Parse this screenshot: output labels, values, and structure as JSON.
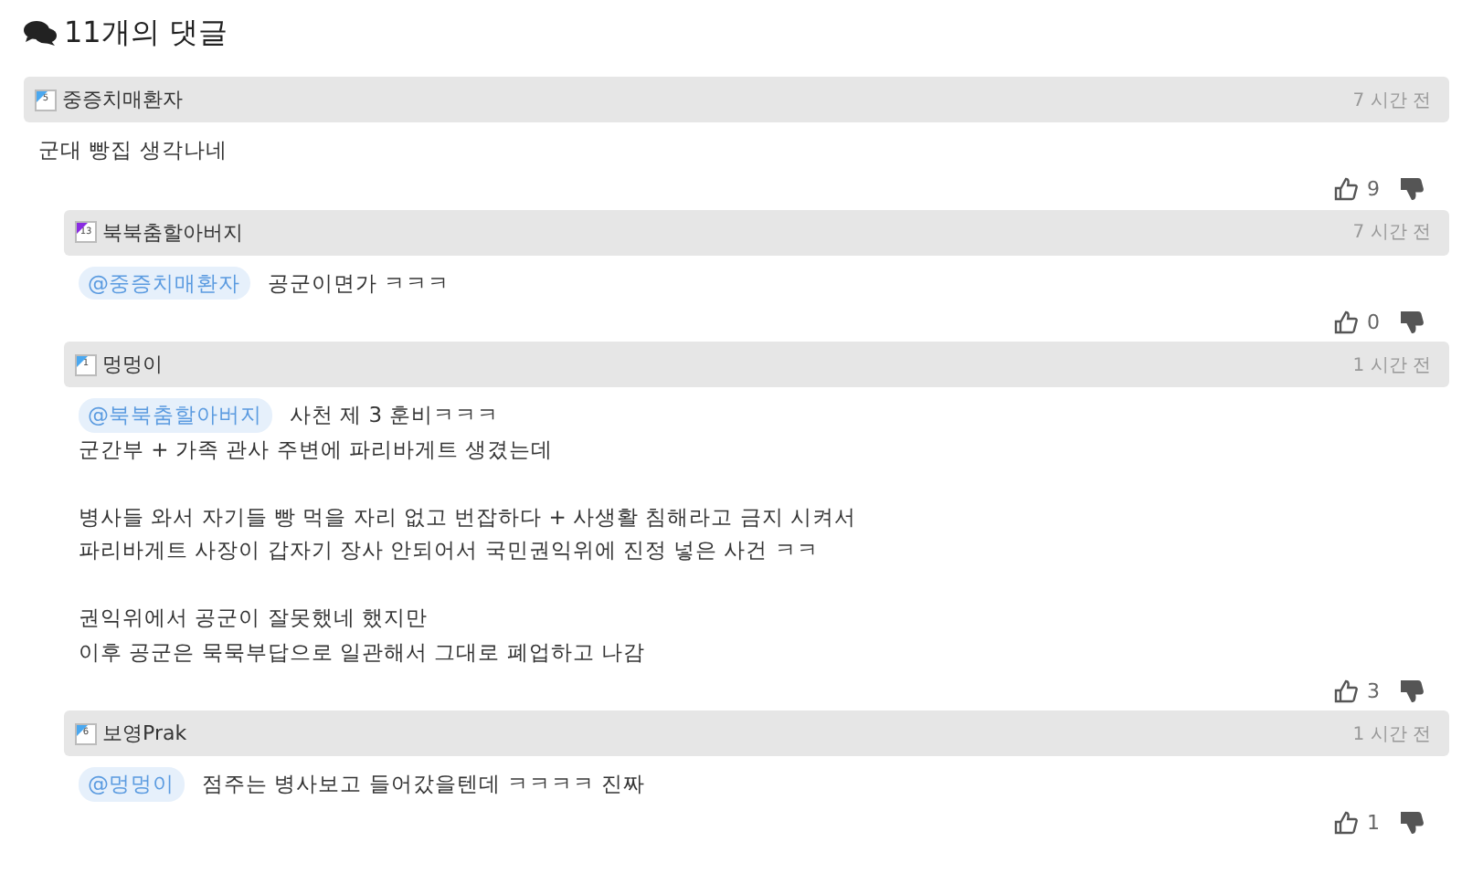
{
  "heading": "11개의 댓글",
  "comments": [
    {
      "author": "중증치매환자",
      "level_badge": "5",
      "color": "#4aa8f0",
      "time": "7 시간 전",
      "paragraphs": [
        [
          "군대 빵집 생각나네"
        ]
      ],
      "likes": "9",
      "children": [
        {
          "author": "북북춤할아버지",
          "level_badge": "13",
          "color": "#8a2be2",
          "time": "7 시간 전",
          "mention": "@중증치매환자",
          "paragraphs": [
            [
              "공군이면가 ㅋㅋㅋ"
            ]
          ],
          "likes": "0"
        },
        {
          "author": "멍멍이",
          "level_badge": "1",
          "color": "#4aa8f0",
          "time": "1 시간 전",
          "mention": "@북북춤할아버지",
          "paragraphs": [
            [
              "사천 제 3 훈비ㅋㅋㅋ",
              "군간부 + 가족 관사 주변에 파리바게트 생겼는데"
            ],
            [
              "병사들 와서 자기들 빵 먹을 자리 없고 번잡하다 + 사생활 침해라고 금지 시켜서",
              "파리바게트 사장이 갑자기 장사 안되어서 국민권익위에 진정 넣은 사건 ㅋㅋ"
            ],
            [
              "권익위에서 공군이 잘못했네 했지만",
              "이후 공군은 묵묵부답으로 일관해서 그대로 폐업하고 나감"
            ]
          ],
          "likes": "3"
        },
        {
          "author": "보영Prak",
          "level_badge": "6",
          "color": "#4aa8f0",
          "time": "1 시간 전",
          "mention": "@멍멍이",
          "paragraphs": [
            [
              "점주는 병사보고 들어갔을텐데 ㅋㅋㅋㅋ 진짜"
            ]
          ],
          "likes": "1"
        }
      ]
    }
  ]
}
